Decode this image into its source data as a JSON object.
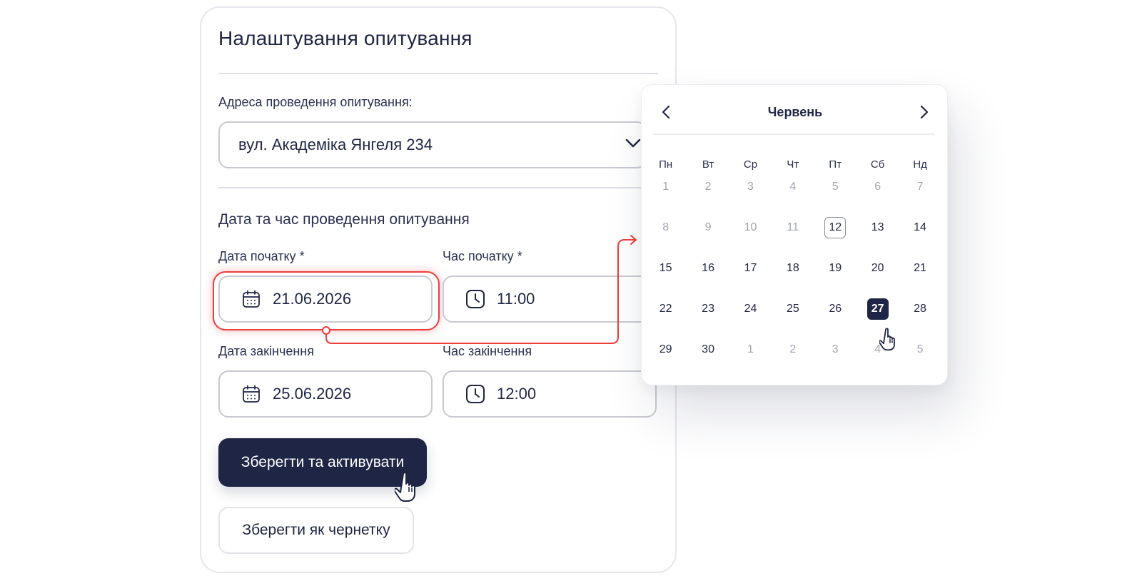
{
  "form": {
    "title": "Налаштування опитування",
    "address_label": "Адреса проведення опитування:",
    "address_value": "вул. Академіка Янгеля 234",
    "section_title": "Дата та час проведення опитування",
    "start_date_label": "Дата початку",
    "start_time_label": "Час початку",
    "required_mark": "*",
    "start_date_value": "21.06.2026",
    "start_time_value": "11:00",
    "end_date_label": "Дата закінчення",
    "end_time_label": "Час закінчення",
    "end_date_value": "25.06.2026",
    "end_time_value": "12:00",
    "save_activate_label": "Зберегти та активувати",
    "save_draft_label": "Зберегти як чернетку"
  },
  "calendar": {
    "month": "Червень",
    "weekdays": [
      "Пн",
      "Вт",
      "Ср",
      "Чт",
      "Пт",
      "Сб",
      "Нд"
    ],
    "weeks": [
      [
        {
          "d": "1",
          "muted": true
        },
        {
          "d": "2",
          "muted": true
        },
        {
          "d": "3",
          "muted": true
        },
        {
          "d": "4",
          "muted": true
        },
        {
          "d": "5",
          "muted": true
        },
        {
          "d": "6",
          "muted": true
        },
        {
          "d": "7",
          "muted": true
        }
      ],
      [
        {
          "d": "8",
          "muted": true
        },
        {
          "d": "9",
          "muted": true
        },
        {
          "d": "10",
          "muted": true
        },
        {
          "d": "11",
          "muted": true
        },
        {
          "d": "12",
          "today": true
        },
        {
          "d": "13"
        },
        {
          "d": "14"
        }
      ],
      [
        {
          "d": "15"
        },
        {
          "d": "16"
        },
        {
          "d": "17"
        },
        {
          "d": "18"
        },
        {
          "d": "19"
        },
        {
          "d": "20"
        },
        {
          "d": "21"
        }
      ],
      [
        {
          "d": "22"
        },
        {
          "d": "23"
        },
        {
          "d": "24"
        },
        {
          "d": "25"
        },
        {
          "d": "26"
        },
        {
          "d": "27",
          "selected": true
        },
        {
          "d": "28"
        }
      ],
      [
        {
          "d": "29"
        },
        {
          "d": "30"
        },
        {
          "d": "1",
          "muted": true
        },
        {
          "d": "2",
          "muted": true
        },
        {
          "d": "3",
          "muted": true
        },
        {
          "d": "4",
          "muted": true
        },
        {
          "d": "5",
          "muted": true
        }
      ]
    ]
  },
  "colors": {
    "primary": "#1e2545",
    "highlight": "#ef3d3d",
    "muted_text": "#a3a6b3"
  }
}
